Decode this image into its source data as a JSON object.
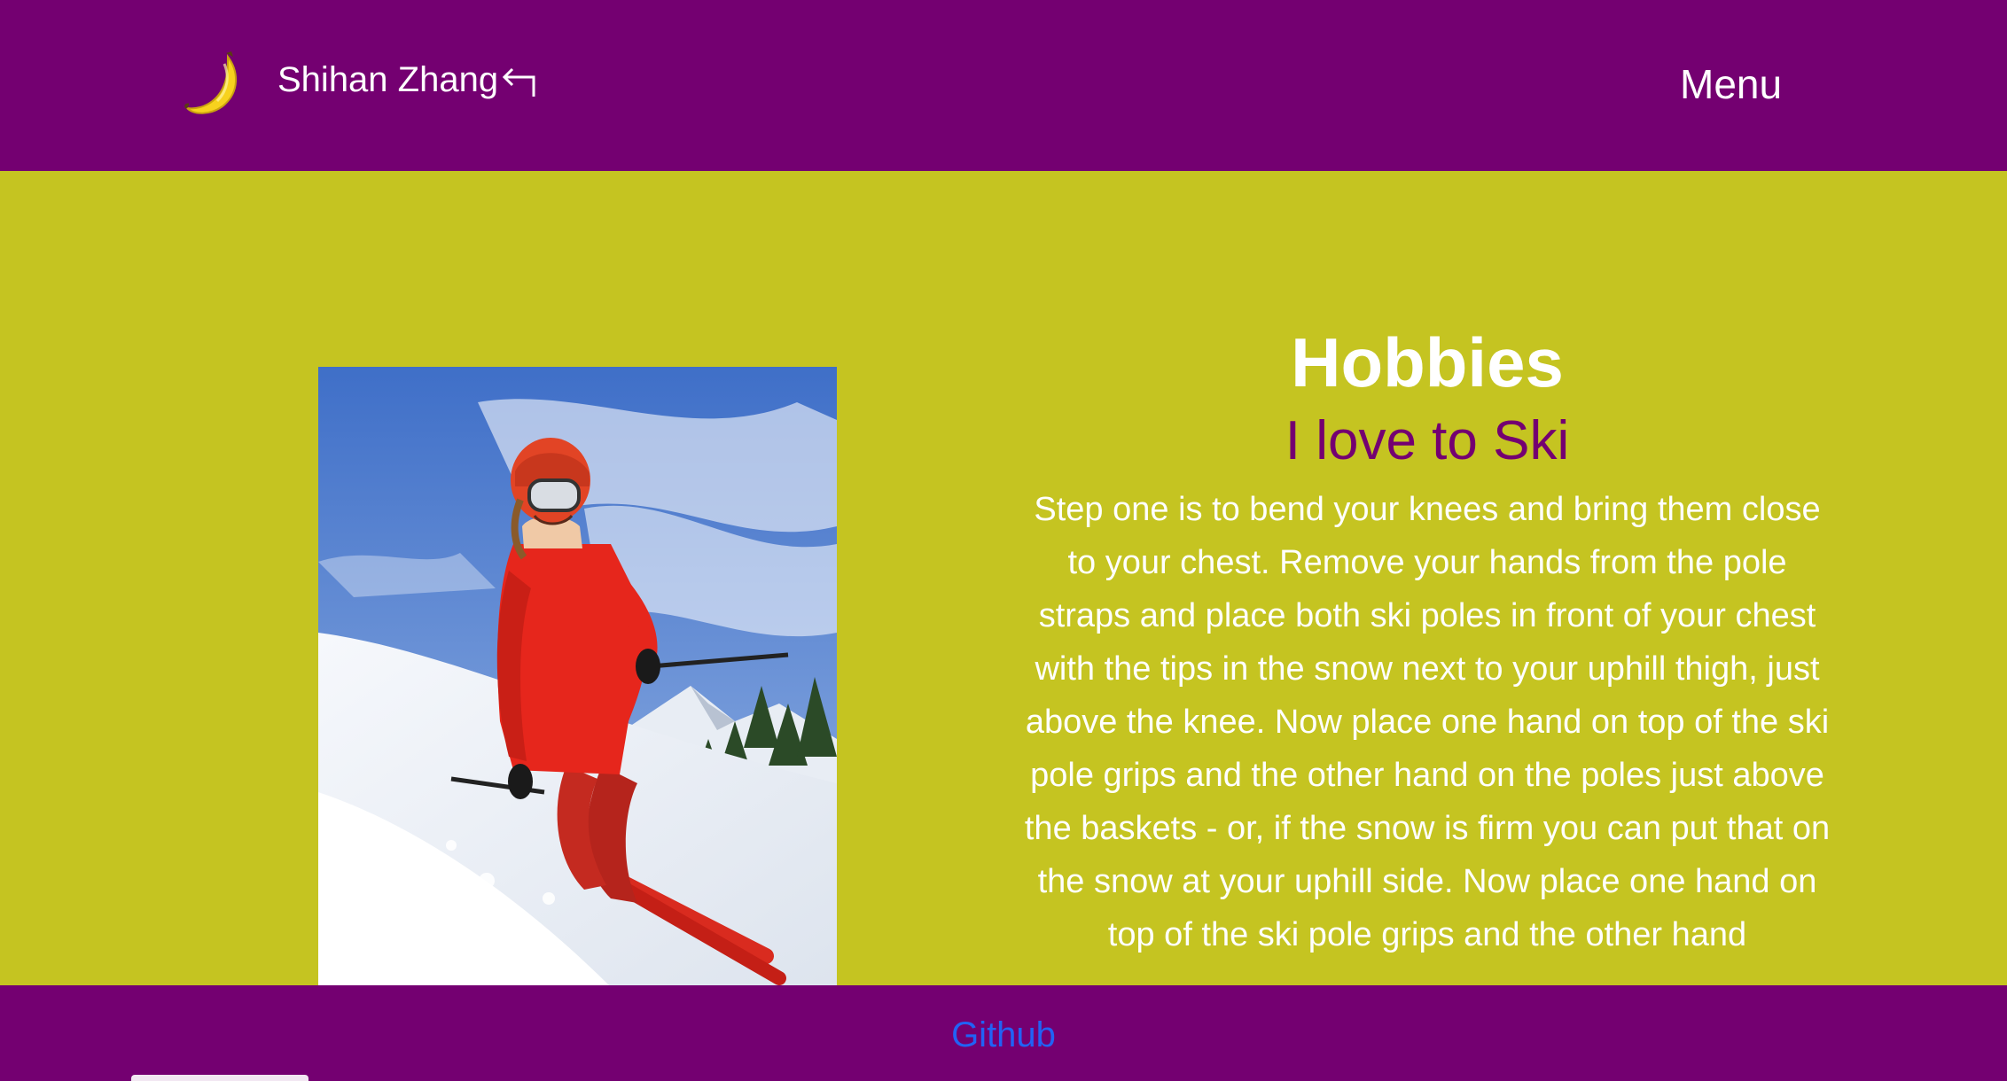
{
  "header": {
    "brand_icon": "banana-icon",
    "brand_name": "Shihan Zhang",
    "back_icon": "return-arrow-icon",
    "menu_label": "Menu"
  },
  "main": {
    "photo_alt": "Skier in red jacket and helmet carving down a snowy slope",
    "title": "Hobbies",
    "subtitle": "I love to Ski",
    "body": "Step one is to bend your knees and bring them close to your chest. Remove your hands from the pole straps and place both ski poles in front of your chest with the tips in the snow next to your uphill thigh, just above the knee. Now place one hand on top of the ski pole grips and the other hand on the poles just above the baskets - or, if the snow is firm you can put that on the snow at your uphill side. Now place one hand on top of the ski pole grips and the other hand"
  },
  "footer": {
    "link_label": "Github"
  },
  "colors": {
    "header_bg": "#740071",
    "main_bg": "#c5c421",
    "subtitle": "#740071",
    "link": "#2162f5"
  }
}
